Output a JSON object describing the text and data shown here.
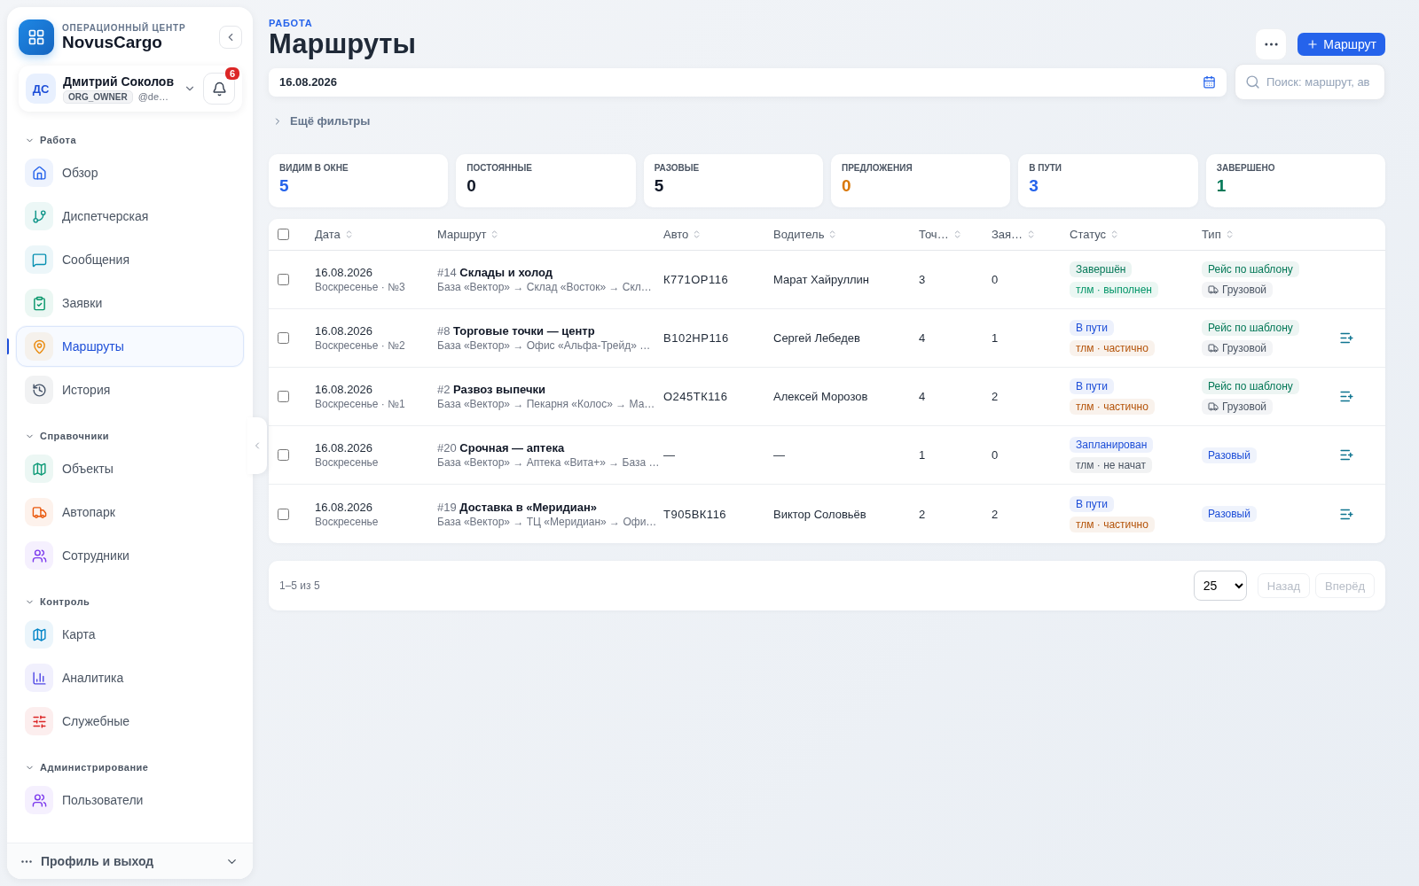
{
  "sidebar": {
    "eyebrow": "ОПЕРАЦИОННЫЙ ЦЕНТР",
    "brand": "NovusCargo",
    "user": {
      "initials": "ДС",
      "name": "Дмитрий Соколов",
      "role": "ORG_OWNER",
      "handle": "@de…",
      "notifications": "6"
    },
    "sections": [
      {
        "title": "Работа",
        "expanded": true,
        "items": [
          {
            "label": "Обзор",
            "color": "#2563eb",
            "selected": false
          },
          {
            "label": "Диспетчерская",
            "color": "#0d9488",
            "selected": false
          },
          {
            "label": "Сообщения",
            "color": "#0891b2",
            "selected": false
          },
          {
            "label": "Заявки",
            "color": "#059669",
            "selected": false
          },
          {
            "label": "Маршруты",
            "color": "#ea8a0c",
            "selected": true
          },
          {
            "label": "История",
            "color": "#475569",
            "selected": false
          }
        ]
      },
      {
        "title": "Справочники",
        "expanded": true,
        "items": [
          {
            "label": "Объекты",
            "color": "#0f9b78",
            "selected": false
          },
          {
            "label": "Автопарк",
            "color": "#ea580c",
            "selected": false
          },
          {
            "label": "Сотрудники",
            "color": "#7c3aed",
            "selected": false
          }
        ]
      },
      {
        "title": "Контроль",
        "expanded": true,
        "items": [
          {
            "label": "Карта",
            "color": "#0284c7",
            "selected": false
          },
          {
            "label": "Аналитика",
            "color": "#4f46e5",
            "selected": false
          },
          {
            "label": "Служебные",
            "color": "#dc2626",
            "selected": false
          }
        ]
      },
      {
        "title": "Администрирование",
        "expanded": true,
        "items": [
          {
            "label": "Пользователи",
            "color": "#7c3aed",
            "selected": false
          }
        ]
      }
    ],
    "footer": "Профиль и выход"
  },
  "header": {
    "eyebrow": "РАБОТА",
    "title": "Маршруты",
    "primary_button": "Маршрут"
  },
  "filters": {
    "date": "16.08.2026",
    "search_placeholder": "Поиск: маршрут, ав",
    "more": "Ещё фильтры"
  },
  "stats": [
    {
      "label": "ВИДИМ В ОКНЕ",
      "value": "5",
      "color": "#2563eb"
    },
    {
      "label": "ПОСТОЯННЫЕ",
      "value": "0",
      "color": "#111827"
    },
    {
      "label": "РАЗОВЫЕ",
      "value": "5",
      "color": "#111827"
    },
    {
      "label": "ПРЕДЛОЖЕНИЯ",
      "value": "0",
      "color": "#d97706"
    },
    {
      "label": "В ПУТИ",
      "value": "3",
      "color": "#2563eb"
    },
    {
      "label": "ЗАВЕРШЕНО",
      "value": "1",
      "color": "#047857"
    }
  ],
  "table": {
    "all_checked": false,
    "columns": [
      "Дата",
      "Маршрут",
      "Авто",
      "Водитель",
      "Точ…",
      "Зая…",
      "Статус",
      "Тип"
    ],
    "rows": [
      {
        "checked": false,
        "date": "16.08.2026",
        "day": "Воскресенье · №3",
        "num": "#14",
        "name": "Склады и холод",
        "path": "База «Вектор» → Склад «Восток» → Скл…",
        "auto": "К771ОР116",
        "driver": "Марат Хайруллин",
        "points": "3",
        "orders": "0",
        "status": [
          {
            "text": "Завершён",
            "color": "#047857"
          },
          {
            "text": "тлм · выполнен",
            "color": "#059669"
          }
        ],
        "type": [
          {
            "kind": "type",
            "text": "Рейс по шаблону",
            "color": "#047857"
          },
          {
            "kind": "vehicle",
            "text": "Грузовой",
            "color": "#4b5563"
          }
        ],
        "action": false
      },
      {
        "checked": false,
        "date": "16.08.2026",
        "day": "Воскресенье · №2",
        "num": "#8",
        "name": "Торговые точки — центр",
        "path": "База «Вектор» → Офис «Альфа-Трейд» …",
        "auto": "В102НР116",
        "driver": "Сергей Лебедев",
        "points": "4",
        "orders": "1",
        "status": [
          {
            "text": "В пути",
            "color": "#1d4ed8"
          },
          {
            "text": "тлм · частично",
            "color": "#b45309"
          }
        ],
        "type": [
          {
            "kind": "type",
            "text": "Рейс по шаблону",
            "color": "#047857"
          },
          {
            "kind": "vehicle",
            "text": "Грузовой",
            "color": "#4b5563"
          }
        ],
        "action": true
      },
      {
        "checked": false,
        "date": "16.08.2026",
        "day": "Воскресенье · №1",
        "num": "#2",
        "name": "Развоз выпечки",
        "path": "База «Вектор» → Пекарня «Колос» → Ма…",
        "auto": "О245ТК116",
        "driver": "Алексей Морозов",
        "points": "4",
        "orders": "2",
        "status": [
          {
            "text": "В пути",
            "color": "#1d4ed8"
          },
          {
            "text": "тлм · частично",
            "color": "#b45309"
          }
        ],
        "type": [
          {
            "kind": "type",
            "text": "Рейс по шаблону",
            "color": "#047857"
          },
          {
            "kind": "vehicle",
            "text": "Грузовой",
            "color": "#4b5563"
          }
        ],
        "action": true
      },
      {
        "checked": false,
        "date": "16.08.2026",
        "day": "Воскресенье",
        "num": "#20",
        "name": "Срочная — аптека",
        "path": "База «Вектор» → Аптека «Вита+» → База …",
        "auto": "—",
        "driver": "—",
        "points": "1",
        "orders": "0",
        "status": [
          {
            "text": "Запланирован",
            "color": "#1d4ed8"
          },
          {
            "text": "тлм · не начат",
            "color": "#4b5563"
          }
        ],
        "type": [
          {
            "kind": "type",
            "text": "Разовый",
            "color": "#1d4ed8"
          }
        ],
        "action": true
      },
      {
        "checked": false,
        "date": "16.08.2026",
        "day": "Воскресенье",
        "num": "#19",
        "name": "Доставка в «Меридиан»",
        "path": "База «Вектор» → ТЦ «Меридиан» → Офи…",
        "auto": "Т905ВК116",
        "driver": "Виктор Соловьёв",
        "points": "2",
        "orders": "2",
        "status": [
          {
            "text": "В пути",
            "color": "#1d4ed8"
          },
          {
            "text": "тлм · частично",
            "color": "#b45309"
          }
        ],
        "type": [
          {
            "kind": "type",
            "text": "Разовый",
            "color": "#1d4ed8"
          }
        ],
        "action": true
      }
    ]
  },
  "pagination": {
    "range": "1–5 из 5",
    "page_size": "25",
    "prev": "Назад",
    "next": "Вперёд",
    "prev_disabled": true,
    "next_disabled": true
  }
}
